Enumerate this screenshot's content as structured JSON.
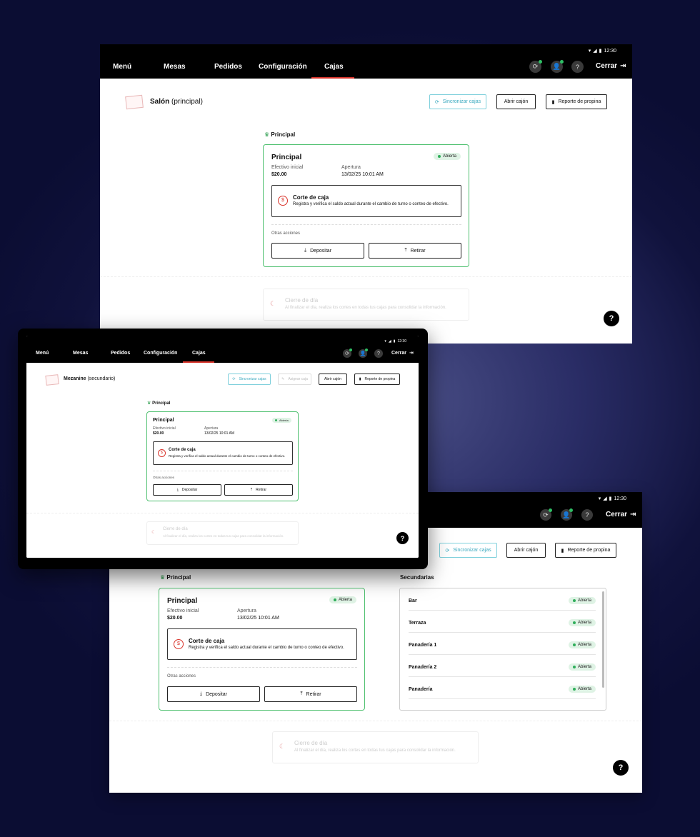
{
  "status": {
    "time": "12:30"
  },
  "nav": {
    "tabs": [
      "Menú",
      "Mesas",
      "Pedidos",
      "Configuración",
      "Cajas"
    ],
    "active_tab": "Cajas",
    "close_label": "Cerrar"
  },
  "toolbar": {
    "sync_label": "Sincronizar cajas",
    "assign_label": "Asignar caja",
    "open_drawer_label": "Abrir cajón",
    "tips_label": "Reporte de propina"
  },
  "screen1": {
    "location_name": "Salón",
    "location_type": "(principal)"
  },
  "screen2": {
    "location_name": "Mezanine",
    "location_type": "(secundario)"
  },
  "principal": {
    "section_label": "Principal",
    "card_title": "Principal",
    "status": "Abierta",
    "initial_cash_label": "Efectivo inicial",
    "initial_cash_value": "$20.00",
    "opening_label": "Apertura",
    "opening_value": "13/02/25 10:01 AM",
    "corte_title": "Corte de caja",
    "corte_desc": "Registra y verifica el saldo actual durante el cambio de turno o conteo de efectivo.",
    "other_actions_label": "Otras acciones",
    "deposit_label": "Depositar",
    "withdraw_label": "Retirar"
  },
  "closing": {
    "title": "Cierre de día",
    "desc": "Al finalizar el día, realiza los cortes en todas tus cajas para consolidar la información."
  },
  "help_label": "?",
  "secondaries": {
    "section_label": "Secundarias",
    "items": [
      {
        "name": "Bar",
        "status": "Abierta"
      },
      {
        "name": "Terraza",
        "status": "Abierta"
      },
      {
        "name": "Panadería 1",
        "status": "Abierta"
      },
      {
        "name": "Panadería 2",
        "status": "Abierta"
      },
      {
        "name": "Panadería",
        "status": "Abierta"
      }
    ]
  },
  "colors": {
    "accent_red": "#d9342b",
    "open_green": "#2fae5a",
    "sync_blue": "#3aa9bf"
  }
}
